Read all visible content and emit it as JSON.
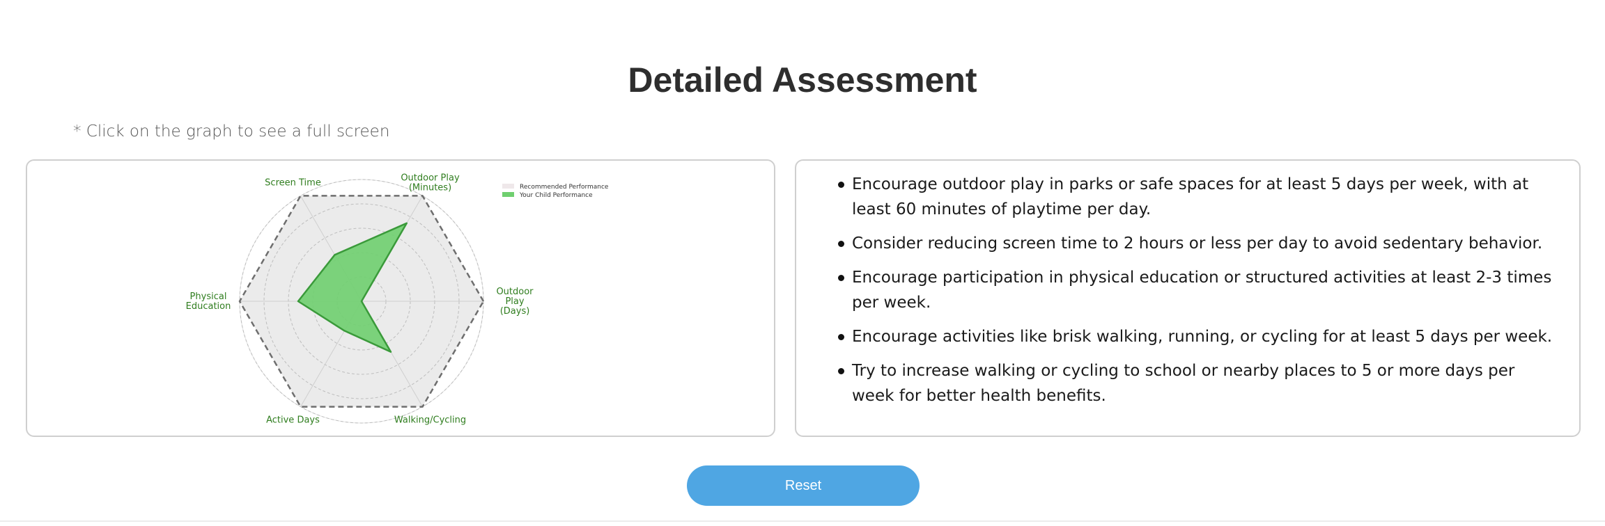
{
  "page": {
    "title": "Detailed Assessment",
    "hint": "* Click on the graph to see a full screen"
  },
  "chart_data": {
    "type": "radar",
    "title": "",
    "axes": [
      {
        "label": "Outdoor\nPlay\n(Days)"
      },
      {
        "label": "Outdoor Play\n(Minutes)"
      },
      {
        "label": "Screen Time"
      },
      {
        "label": "Physical\nEducation"
      },
      {
        "label": "Active Days"
      },
      {
        "label": "Walking/Cycling"
      }
    ],
    "rmax": 5,
    "gridlines": [
      1,
      2,
      3,
      4,
      5
    ],
    "series": [
      {
        "name": "Recommended Performance",
        "values": [
          5,
          5,
          5,
          5,
          5,
          5
        ],
        "color": "#ebebeb",
        "edge": "#6e6e6e",
        "dashed": true
      },
      {
        "name": "Your Child Performance",
        "values": [
          0,
          3.7,
          2.2,
          2.6,
          1.4,
          2.4
        ],
        "color": "#6fcf6f",
        "edge": "#3a9a3a",
        "dashed": false
      }
    ],
    "legend_position": "top-right",
    "axis_label_color": "#2f7d1e"
  },
  "tips": [
    "Encourage outdoor play in parks or safe spaces for at least 5 days per week, with at least 60 minutes of playtime per day.",
    "Consider reducing screen time to 2 hours or less per day to avoid sedentary behavior.",
    "Encourage participation in physical education or structured activities at least 2-3 times per week.",
    "Encourage activities like brisk walking, running, or cycling for at least 5 days per week.",
    "Try to increase walking or cycling to school or nearby places to 5 or more days per week for better health benefits."
  ],
  "reset": {
    "label": "Reset"
  },
  "colors": {
    "reset_button": "#4fa6e3",
    "card_border": "#cfcfcf"
  }
}
